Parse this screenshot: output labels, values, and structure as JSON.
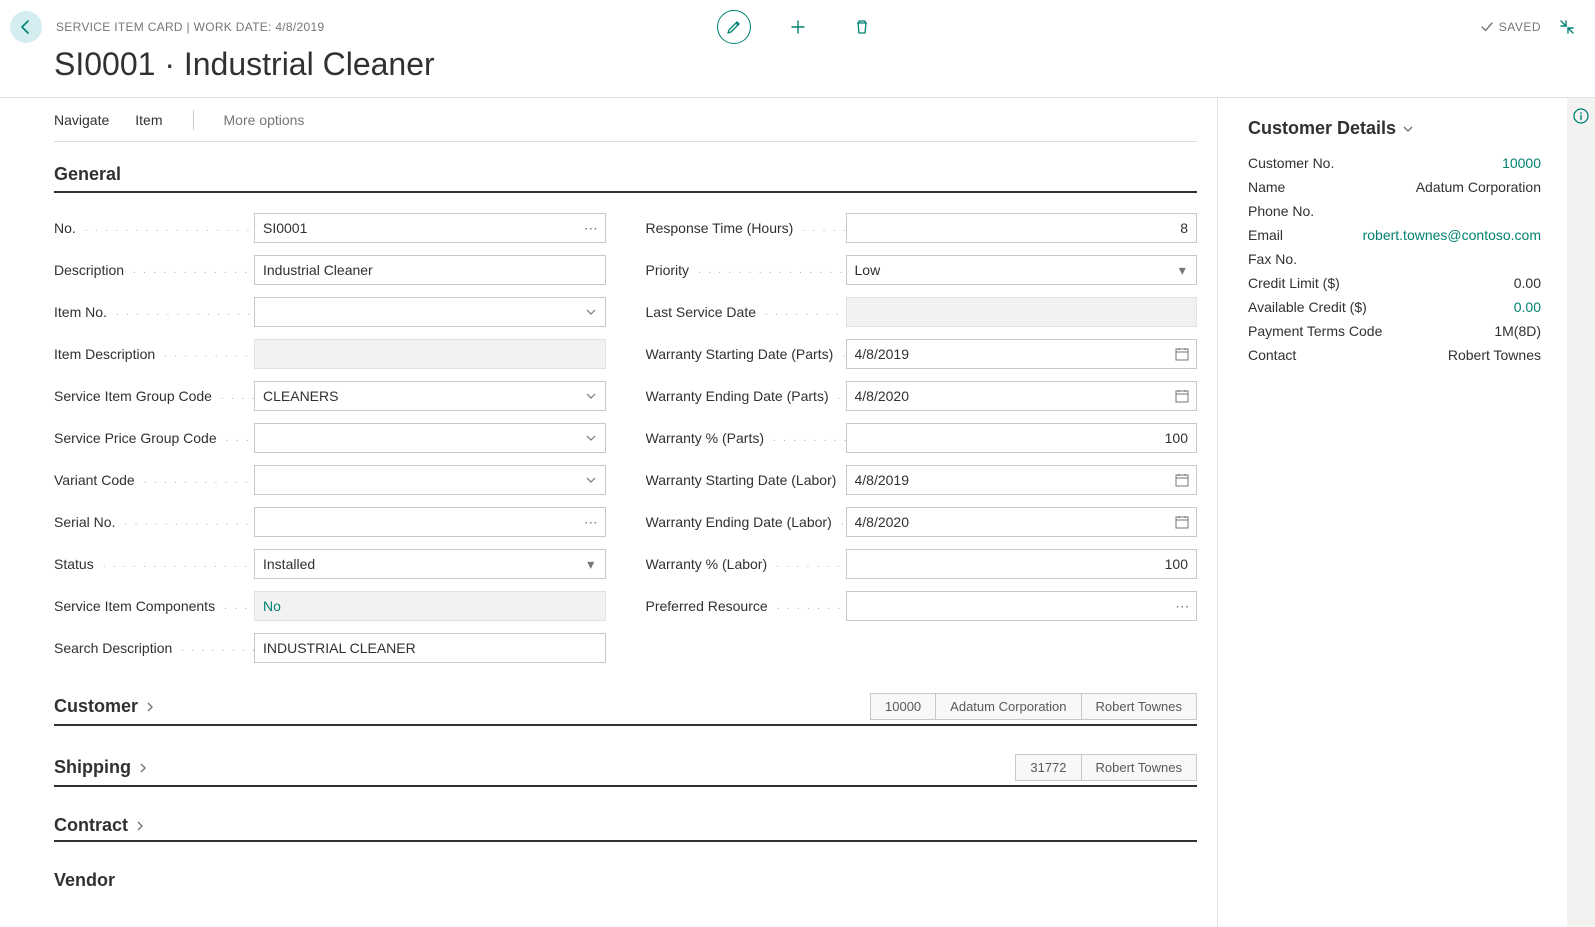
{
  "header": {
    "breadcrumb": "SERVICE ITEM CARD | WORK DATE: 4/8/2019",
    "saved": "SAVED"
  },
  "title": "SI0001 · Industrial Cleaner",
  "commandbar": {
    "navigate": "Navigate",
    "item": "Item",
    "more": "More options"
  },
  "sections": {
    "general": {
      "title": "General",
      "fields": {
        "no_label": "No.",
        "no_value": "SI0001",
        "description_label": "Description",
        "description_value": "Industrial Cleaner",
        "item_no_label": "Item No.",
        "item_no_value": "",
        "item_description_label": "Item Description",
        "item_description_value": "",
        "service_item_group_label": "Service Item Group Code",
        "service_item_group_value": "CLEANERS",
        "service_price_group_label": "Service Price Group Code",
        "service_price_group_value": "",
        "variant_code_label": "Variant Code",
        "variant_code_value": "",
        "serial_no_label": "Serial No.",
        "serial_no_value": "",
        "status_label": "Status",
        "status_value": "Installed",
        "components_label": "Service Item Components",
        "components_value": "No",
        "search_desc_label": "Search Description",
        "search_desc_value": "INDUSTRIAL CLEANER",
        "response_time_label": "Response Time (Hours)",
        "response_time_value": "8",
        "priority_label": "Priority",
        "priority_value": "Low",
        "last_service_date_label": "Last Service Date",
        "last_service_date_value": "",
        "warranty_start_parts_label": "Warranty Starting Date (Parts)",
        "warranty_start_parts_value": "4/8/2019",
        "warranty_end_parts_label": "Warranty Ending Date (Parts)",
        "warranty_end_parts_value": "4/8/2020",
        "warranty_pct_parts_label": "Warranty % (Parts)",
        "warranty_pct_parts_value": "100",
        "warranty_start_labor_label": "Warranty Starting Date (Labor)",
        "warranty_start_labor_value": "4/8/2019",
        "warranty_end_labor_label": "Warranty Ending Date (Labor)",
        "warranty_end_labor_value": "4/8/2020",
        "warranty_pct_labor_label": "Warranty % (Labor)",
        "warranty_pct_labor_value": "100",
        "preferred_resource_label": "Preferred Resource",
        "preferred_resource_value": ""
      }
    },
    "customer": {
      "title": "Customer",
      "summary": [
        "10000",
        "Adatum Corporation",
        "Robert Townes"
      ]
    },
    "shipping": {
      "title": "Shipping",
      "summary": [
        "31772",
        "Robert Townes"
      ]
    },
    "contract": {
      "title": "Contract"
    },
    "vendor": {
      "title": "Vendor"
    }
  },
  "factbox": {
    "title": "Customer Details",
    "rows": {
      "customer_no_label": "Customer No.",
      "customer_no_value": "10000",
      "name_label": "Name",
      "name_value": "Adatum Corporation",
      "phone_label": "Phone No.",
      "phone_value": "",
      "email_label": "Email",
      "email_value": "robert.townes@contoso.com",
      "fax_label": "Fax No.",
      "fax_value": "",
      "credit_limit_label": "Credit Limit ($)",
      "credit_limit_value": "0.00",
      "available_credit_label": "Available Credit ($)",
      "available_credit_value": "0.00",
      "payment_terms_label": "Payment Terms Code",
      "payment_terms_value": "1M(8D)",
      "contact_label": "Contact",
      "contact_value": "Robert Townes"
    }
  }
}
